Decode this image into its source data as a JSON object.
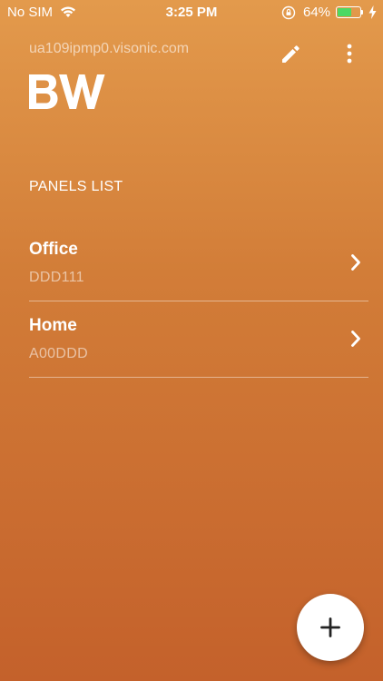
{
  "status_bar": {
    "carrier": "No SIM",
    "time": "3:25 PM",
    "battery_percent": "64%",
    "battery_level": 0.64,
    "battery_color": "#4cd964",
    "icons": [
      "wifi-icon",
      "rotation-lock-icon",
      "battery-icon",
      "charging-bolt-icon"
    ]
  },
  "header": {
    "server_address": "ua109ipmp0.visonic.com",
    "logo_text": "BW",
    "actions": [
      "edit-icon",
      "more-vert-icon"
    ]
  },
  "panels_section": {
    "title": "PANELS LIST",
    "items": [
      {
        "name": "Office",
        "id": "DDD111"
      },
      {
        "name": "Home",
        "id": "A00DDD"
      }
    ]
  },
  "fab": {
    "icon": "plus-icon"
  },
  "colors": {
    "gradient_top": "#e39a4c",
    "gradient_bottom": "#c4612b",
    "text": "#ffffff"
  }
}
